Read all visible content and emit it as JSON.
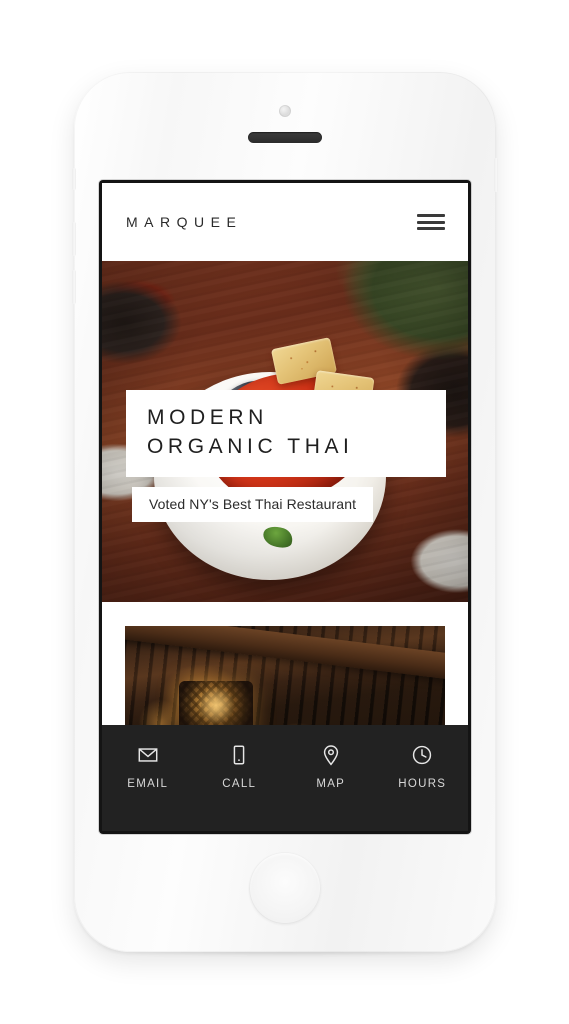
{
  "device": {
    "name": "white-smartphone-mockup",
    "camera": "front-camera",
    "speaker": "earpiece-speaker",
    "home_button": "home-button"
  },
  "site": {
    "header": {
      "brand": "MARQUEE",
      "menu_icon": "hamburger-menu-icon"
    },
    "hero": {
      "title_line1": "MODERN",
      "title_line2": "ORGANIC THAI",
      "subtitle": "Voted NY's Best Thai Restaurant",
      "scroll_indicator": "chevron-down-icon",
      "photo_alt": "Thai crispy tofu with red chili sauce on white plate"
    },
    "interior": {
      "photo_alt": "Dark restaurant interior with wooden beams and pendant lighting"
    },
    "bottom_nav": {
      "items": [
        {
          "label": "EMAIL",
          "icon": "envelope-icon"
        },
        {
          "label": "CALL",
          "icon": "phone-icon"
        },
        {
          "label": "MAP",
          "icon": "map-pin-icon"
        },
        {
          "label": "HOURS",
          "icon": "clock-icon"
        }
      ]
    }
  },
  "colors": {
    "page_background": "#ffffff",
    "device_body": "#f7f7f7",
    "screen_border": "#141414",
    "nav_background": "#222222",
    "nav_label": "#d8d8d8",
    "brand_text": "#2a2a2a",
    "hero_title_text": "#1f1f1f"
  }
}
